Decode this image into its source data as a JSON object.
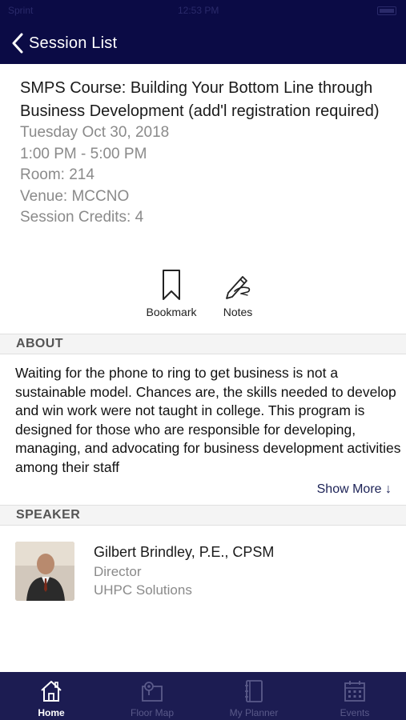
{
  "status_bar": {
    "carrier": "Sprint",
    "time": "12:53 PM"
  },
  "nav": {
    "back_label": "Session List"
  },
  "session": {
    "title": "SMPS Course: Building Your Bottom Line through Business Development (add'l registration required)",
    "date": "Tuesday Oct 30, 2018",
    "time": "1:00 PM - 5:00 PM",
    "room": "Room: 214",
    "venue": "Venue: MCCNO",
    "credits": "Session Credits: 4"
  },
  "actions": {
    "bookmark_label": "Bookmark",
    "notes_label": "Notes"
  },
  "about": {
    "header": "ABOUT",
    "text": "Waiting for the phone to ring to get business is not a sustainable model. Chances are, the skills needed to develop and win work were not taught in college. This program is designed for those who are responsible for developing, managing, and advocating for business development activities among their staff",
    "show_more": "Show More ↓"
  },
  "speaker": {
    "header": "SPEAKER",
    "name": "Gilbert Brindley, P.E., CPSM",
    "title": "Director",
    "organization": "UHPC Solutions"
  },
  "tab_bar": {
    "home": "Home",
    "floor_map": "Floor Map",
    "my_planner": "My Planner",
    "events": "Events"
  },
  "colors": {
    "nav_background": "#0b0b45",
    "tab_background": "#1c1c52",
    "tab_inactive": "#5a5a8a",
    "link": "#1c2256"
  },
  "icons": {
    "back": "chevron-left-icon",
    "bookmark": "bookmark-icon",
    "notes": "pencil-hand-icon",
    "home": "home-icon",
    "floor_map": "map-pin-icon",
    "my_planner": "notebook-icon",
    "events": "calendar-icon"
  }
}
